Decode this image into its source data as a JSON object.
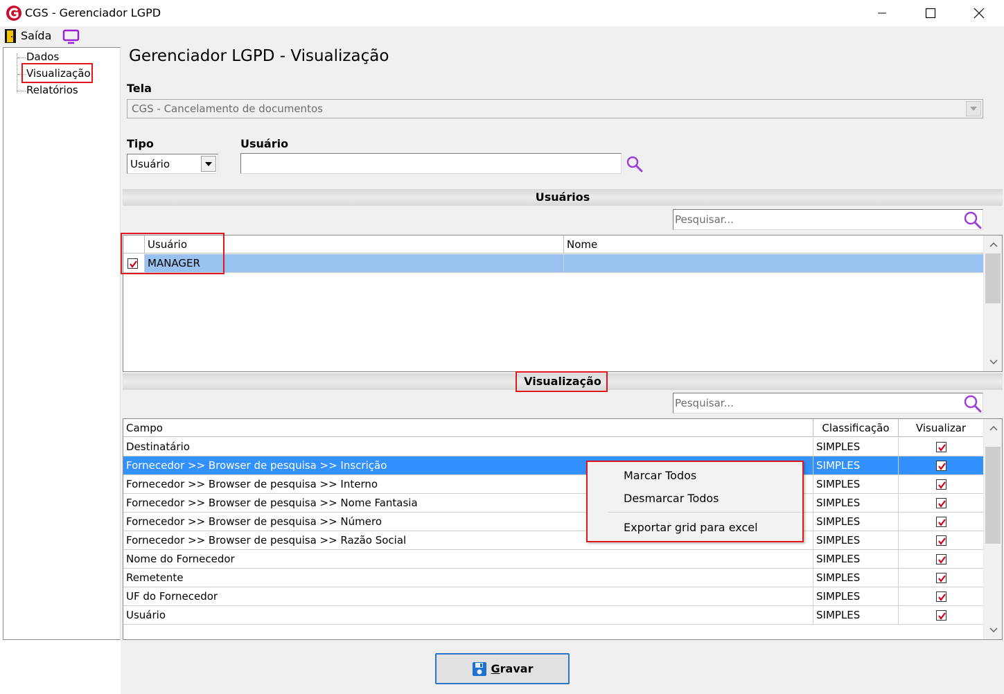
{
  "window": {
    "title": "CGS - Gerenciador LGPD"
  },
  "toolbar": {
    "exit_label": "Saída"
  },
  "tree": {
    "items": [
      {
        "label": "Dados"
      },
      {
        "label": "Visualização"
      },
      {
        "label": "Relatórios"
      }
    ]
  },
  "page": {
    "title": "Gerenciador LGPD - Visualização"
  },
  "form": {
    "tela_label": "Tela",
    "tela_value": "CGS - Cancelamento de documentos",
    "tipo_label": "Tipo",
    "tipo_value": "Usuário",
    "usuario_label": "Usuário",
    "usuario_value": ""
  },
  "users_section": {
    "title": "Usuários",
    "search_placeholder": "Pesquisar...",
    "columns": [
      "Usuário",
      "Nome"
    ],
    "rows": [
      {
        "checked": true,
        "usuario": "MANAGER",
        "nome": ""
      }
    ]
  },
  "view_section": {
    "title": "Visualização",
    "search_placeholder": "Pesquisar...",
    "columns": [
      "Campo",
      "Classificação",
      "Visualizar"
    ],
    "rows": [
      {
        "campo": "Destinatário",
        "classificacao": "SIMPLES",
        "visualizar": true
      },
      {
        "campo": "Fornecedor >> Browser de pesquisa >> Inscrição",
        "classificacao": "SIMPLES",
        "visualizar": true
      },
      {
        "campo": "Fornecedor >> Browser de pesquisa >> Interno",
        "classificacao": "SIMPLES",
        "visualizar": true
      },
      {
        "campo": "Fornecedor >> Browser de pesquisa >> Nome Fantasia",
        "classificacao": "SIMPLES",
        "visualizar": true
      },
      {
        "campo": "Fornecedor >> Browser de pesquisa >> Número",
        "classificacao": "SIMPLES",
        "visualizar": true
      },
      {
        "campo": "Fornecedor >> Browser de pesquisa >> Razão Social",
        "classificacao": "SIMPLES",
        "visualizar": true
      },
      {
        "campo": "Nome do Fornecedor",
        "classificacao": "SIMPLES",
        "visualizar": true
      },
      {
        "campo": "Remetente",
        "classificacao": "SIMPLES",
        "visualizar": true
      },
      {
        "campo": "UF do Fornecedor",
        "classificacao": "SIMPLES",
        "visualizar": true
      },
      {
        "campo": "Usuário",
        "classificacao": "SIMPLES",
        "visualizar": true
      }
    ]
  },
  "context_menu": {
    "items": [
      "Marcar Todos",
      "Desmarcar Todos",
      "Exportar grid para excel"
    ]
  },
  "save_button": {
    "label_first": "G",
    "label_rest": "ravar"
  },
  "colors": {
    "highlight": "#e0161c",
    "selection": "#3390ff",
    "check": "#d0021b",
    "search_icon": "#9b3fd6",
    "brand": "#c8102e"
  },
  "icons": {
    "app": "cgs-logo-icon",
    "exit": "exit-door-icon",
    "monitor": "monitor-icon",
    "search": "search-icon",
    "save": "floppy-disk-icon"
  }
}
